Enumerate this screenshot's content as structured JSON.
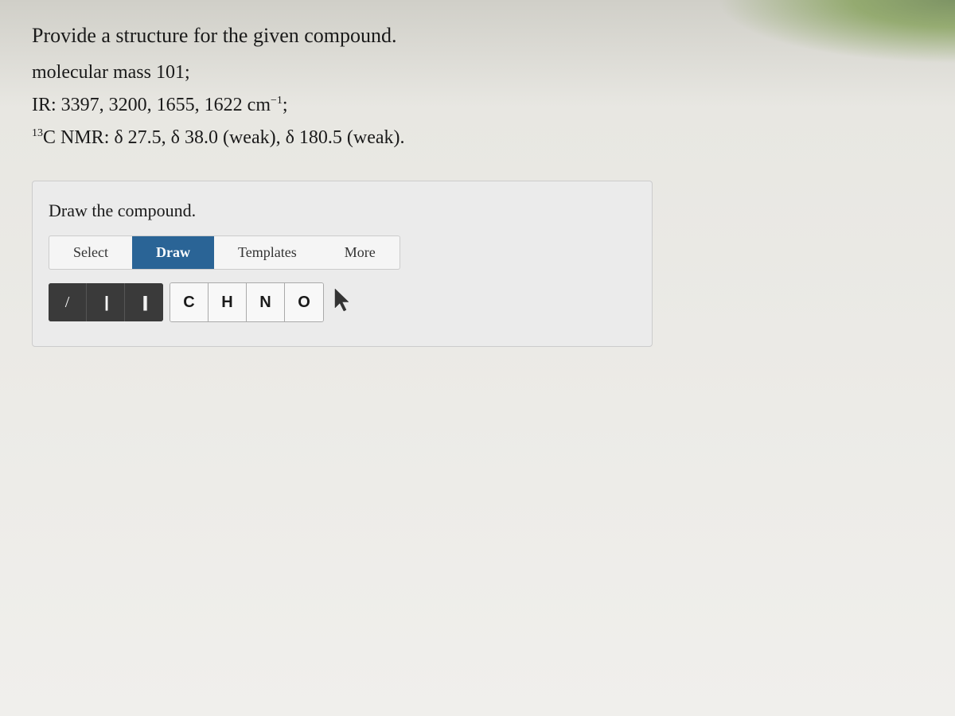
{
  "question": {
    "title": "Provide a structure for the given compound.",
    "molecular_mass": "molecular mass 101;",
    "ir": "IR: 3397, 3200, 1655, 1622 cm",
    "ir_superscript": "−1",
    "ir_end": ";",
    "nmr_prefix": "13",
    "nmr_label": "C NMR: δ 27.5, δ 38.0 (weak), δ 180.5 (weak).",
    "draw_section_title": "Draw the compound."
  },
  "toolbar": {
    "tabs": [
      {
        "id": "select",
        "label": "Select",
        "active": false
      },
      {
        "id": "draw",
        "label": "Draw",
        "active": true
      },
      {
        "id": "templates",
        "label": "Templates",
        "active": false
      },
      {
        "id": "more",
        "label": "More",
        "active": false
      }
    ],
    "bond_tools": [
      {
        "id": "single-bond",
        "symbol": "/"
      },
      {
        "id": "double-bond",
        "symbol": "∥"
      },
      {
        "id": "triple-bond",
        "symbol": "≡"
      }
    ],
    "element_tools": [
      {
        "id": "carbon",
        "label": "C"
      },
      {
        "id": "hydrogen",
        "label": "H"
      },
      {
        "id": "nitrogen",
        "label": "N"
      },
      {
        "id": "oxygen",
        "label": "O"
      }
    ]
  }
}
